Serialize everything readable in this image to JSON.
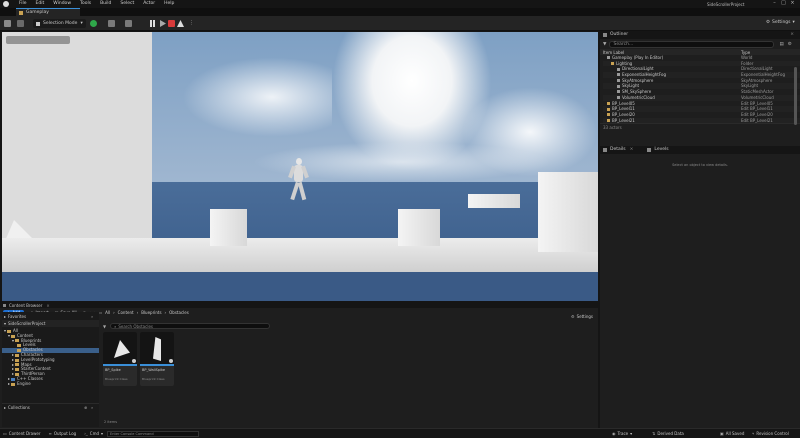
{
  "app": {
    "project_name": "SideScrollerProject",
    "level_tab": "Gameplay",
    "menu": [
      "File",
      "Edit",
      "Window",
      "Tools",
      "Build",
      "Select",
      "Actor",
      "Help"
    ]
  },
  "toolbar": {
    "mode": "Selection Mode",
    "settings": "Settings"
  },
  "outliner": {
    "title": "Outliner",
    "search_placeholder": "Search...",
    "col_label": "Item Label",
    "col_type": "Type",
    "rows": [
      {
        "label": "Gameplay (Play In Editor)",
        "type": "World",
        "link": false
      },
      {
        "label": "Lighting",
        "type": "Folder",
        "link": false
      },
      {
        "label": "DirectionalLight",
        "type": "DirectionalLight",
        "link": false
      },
      {
        "label": "ExponentialHeightFog",
        "type": "ExponentialHeightFog",
        "link": false
      },
      {
        "label": "SkyAtmosphere",
        "type": "SkyAtmosphere",
        "link": false
      },
      {
        "label": "SkyLight",
        "type": "SkyLight",
        "link": false
      },
      {
        "label": "SM_SkySphere",
        "type": "StaticMeshActor",
        "link": false
      },
      {
        "label": "VolumetricCloud",
        "type": "VolumetricCloud",
        "link": false
      },
      {
        "label": "BP_Level05",
        "type": "Edit BP_Level05",
        "link": true
      },
      {
        "label": "BP_Level11",
        "type": "Edit BP_Level11",
        "link": true
      },
      {
        "label": "BP_Level20",
        "type": "Edit BP_Level20",
        "link": true
      },
      {
        "label": "BP_Level21",
        "type": "Edit BP_Level21",
        "link": true
      }
    ],
    "count": "33 actors"
  },
  "details": {
    "tab1": "Details",
    "tab2": "Levels",
    "empty_msg": "Select an object to view details."
  },
  "content_browser": {
    "title": "Content Browser",
    "add": "Add",
    "import": "Import",
    "save_all": "Save All",
    "breadcrumb": [
      "All",
      "Content",
      "Blueprints",
      "Obstacles"
    ],
    "settings": "Settings",
    "search_placeholder": "Search Obstacles",
    "favorites": "Favorites",
    "project": "SideScrollerProject",
    "tree": [
      {
        "label": "All",
        "depth": 0,
        "selected": false
      },
      {
        "label": "Content",
        "depth": 1,
        "selected": false
      },
      {
        "label": "Blueprints",
        "depth": 2,
        "selected": false
      },
      {
        "label": "Levels",
        "depth": 3,
        "selected": false
      },
      {
        "label": "Obstacles",
        "depth": 3,
        "selected": true
      },
      {
        "label": "Characters",
        "depth": 2,
        "selected": false
      },
      {
        "label": "LevelPrototyping",
        "depth": 2,
        "selected": false
      },
      {
        "label": "Maps",
        "depth": 2,
        "selected": false
      },
      {
        "label": "StarterContent",
        "depth": 2,
        "selected": false
      },
      {
        "label": "ThirdPerson",
        "depth": 2,
        "selected": false
      },
      {
        "label": "C++ Classes",
        "depth": 1,
        "selected": false
      },
      {
        "label": "Engine",
        "depth": 1,
        "selected": false
      }
    ],
    "collections": "Collections",
    "assets": [
      {
        "name": "BP_Spike",
        "type": "Blueprint Class"
      },
      {
        "name": "BP_WallSpike",
        "type": "Blueprint Class"
      }
    ],
    "item_count": "2 items"
  },
  "statusbar": {
    "content_drawer": "Content Drawer",
    "output_log": "Output Log",
    "cmd": "Cmd",
    "cmd_placeholder": "Enter Console Command",
    "trace": "Trace",
    "derived_data": "Derived Data",
    "all_saved": "All Saved",
    "revision_control": "Revision Control"
  },
  "colors": {
    "accent": "#3a8fd8",
    "add_button": "#1f6fd1",
    "stop": "#d83a3a",
    "folder": "#c9a253"
  }
}
